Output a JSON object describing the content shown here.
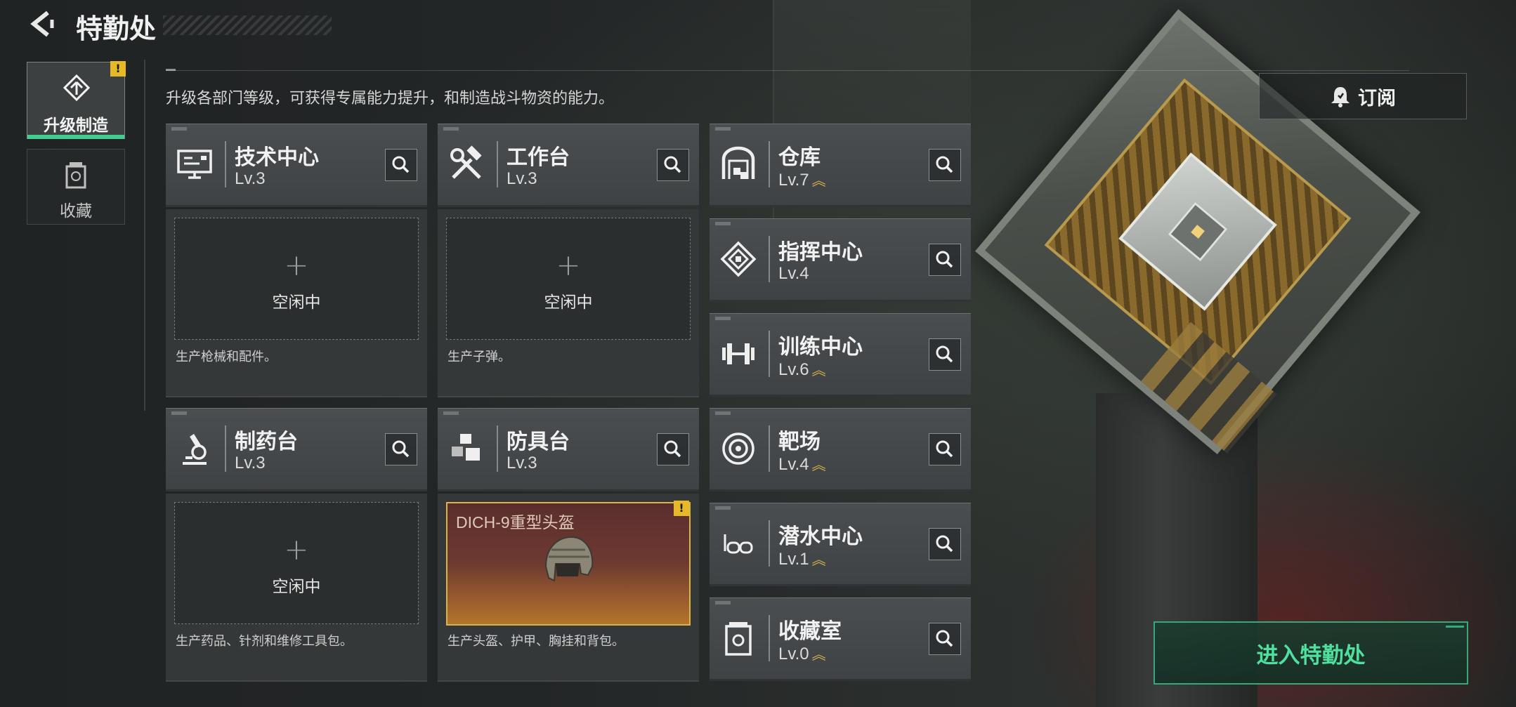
{
  "header": {
    "title": "特勤处"
  },
  "nav": {
    "tabs": [
      {
        "label": "升级制造",
        "active": true,
        "warning": "!"
      },
      {
        "label": "收藏",
        "active": false
      }
    ]
  },
  "subtitle": "升级各部门等级，可获得专属能力提升，和制造战斗物资的能力。",
  "subscribe": {
    "label": "订阅"
  },
  "production_cards": [
    {
      "name": "技术中心",
      "level": "Lv.3",
      "slot_status": "空闲中",
      "description": "生产枪械和配件。",
      "icon": "monitor-icon"
    },
    {
      "name": "工作台",
      "level": "Lv.3",
      "slot_status": "空闲中",
      "description": "生产子弹。",
      "icon": "hammer-wrench-icon"
    },
    {
      "name": "制药台",
      "level": "Lv.3",
      "slot_status": "空闲中",
      "description": "生产药品、针剂和维修工具包。",
      "icon": "microscope-icon"
    },
    {
      "name": "防具台",
      "level": "Lv.3",
      "item_name": "DICH-9重型头盔",
      "item_warning": "!",
      "description": "生产头盔、护甲、胸挂和背包。",
      "icon": "cubes-icon"
    }
  ],
  "departments": [
    {
      "name": "仓库",
      "level": "Lv.7",
      "upgradable": true,
      "icon": "warehouse-icon"
    },
    {
      "name": "指挥中心",
      "level": "Lv.4",
      "upgradable": false,
      "icon": "command-emblem-icon"
    },
    {
      "name": "训练中心",
      "level": "Lv.6",
      "upgradable": true,
      "icon": "dumbbell-icon"
    },
    {
      "name": "靶场",
      "level": "Lv.4",
      "upgradable": true,
      "icon": "target-icon"
    },
    {
      "name": "潜水中心",
      "level": "Lv.1",
      "upgradable": true,
      "icon": "diving-mask-icon"
    },
    {
      "name": "收藏室",
      "level": "Lv.0",
      "upgradable": true,
      "icon": "collection-jar-icon"
    }
  ],
  "enter_button": {
    "label": "进入特勤处"
  },
  "colors": {
    "accent": "#3fcf8e",
    "warning": "#e8b927",
    "upgrade": "#d8b24a"
  }
}
